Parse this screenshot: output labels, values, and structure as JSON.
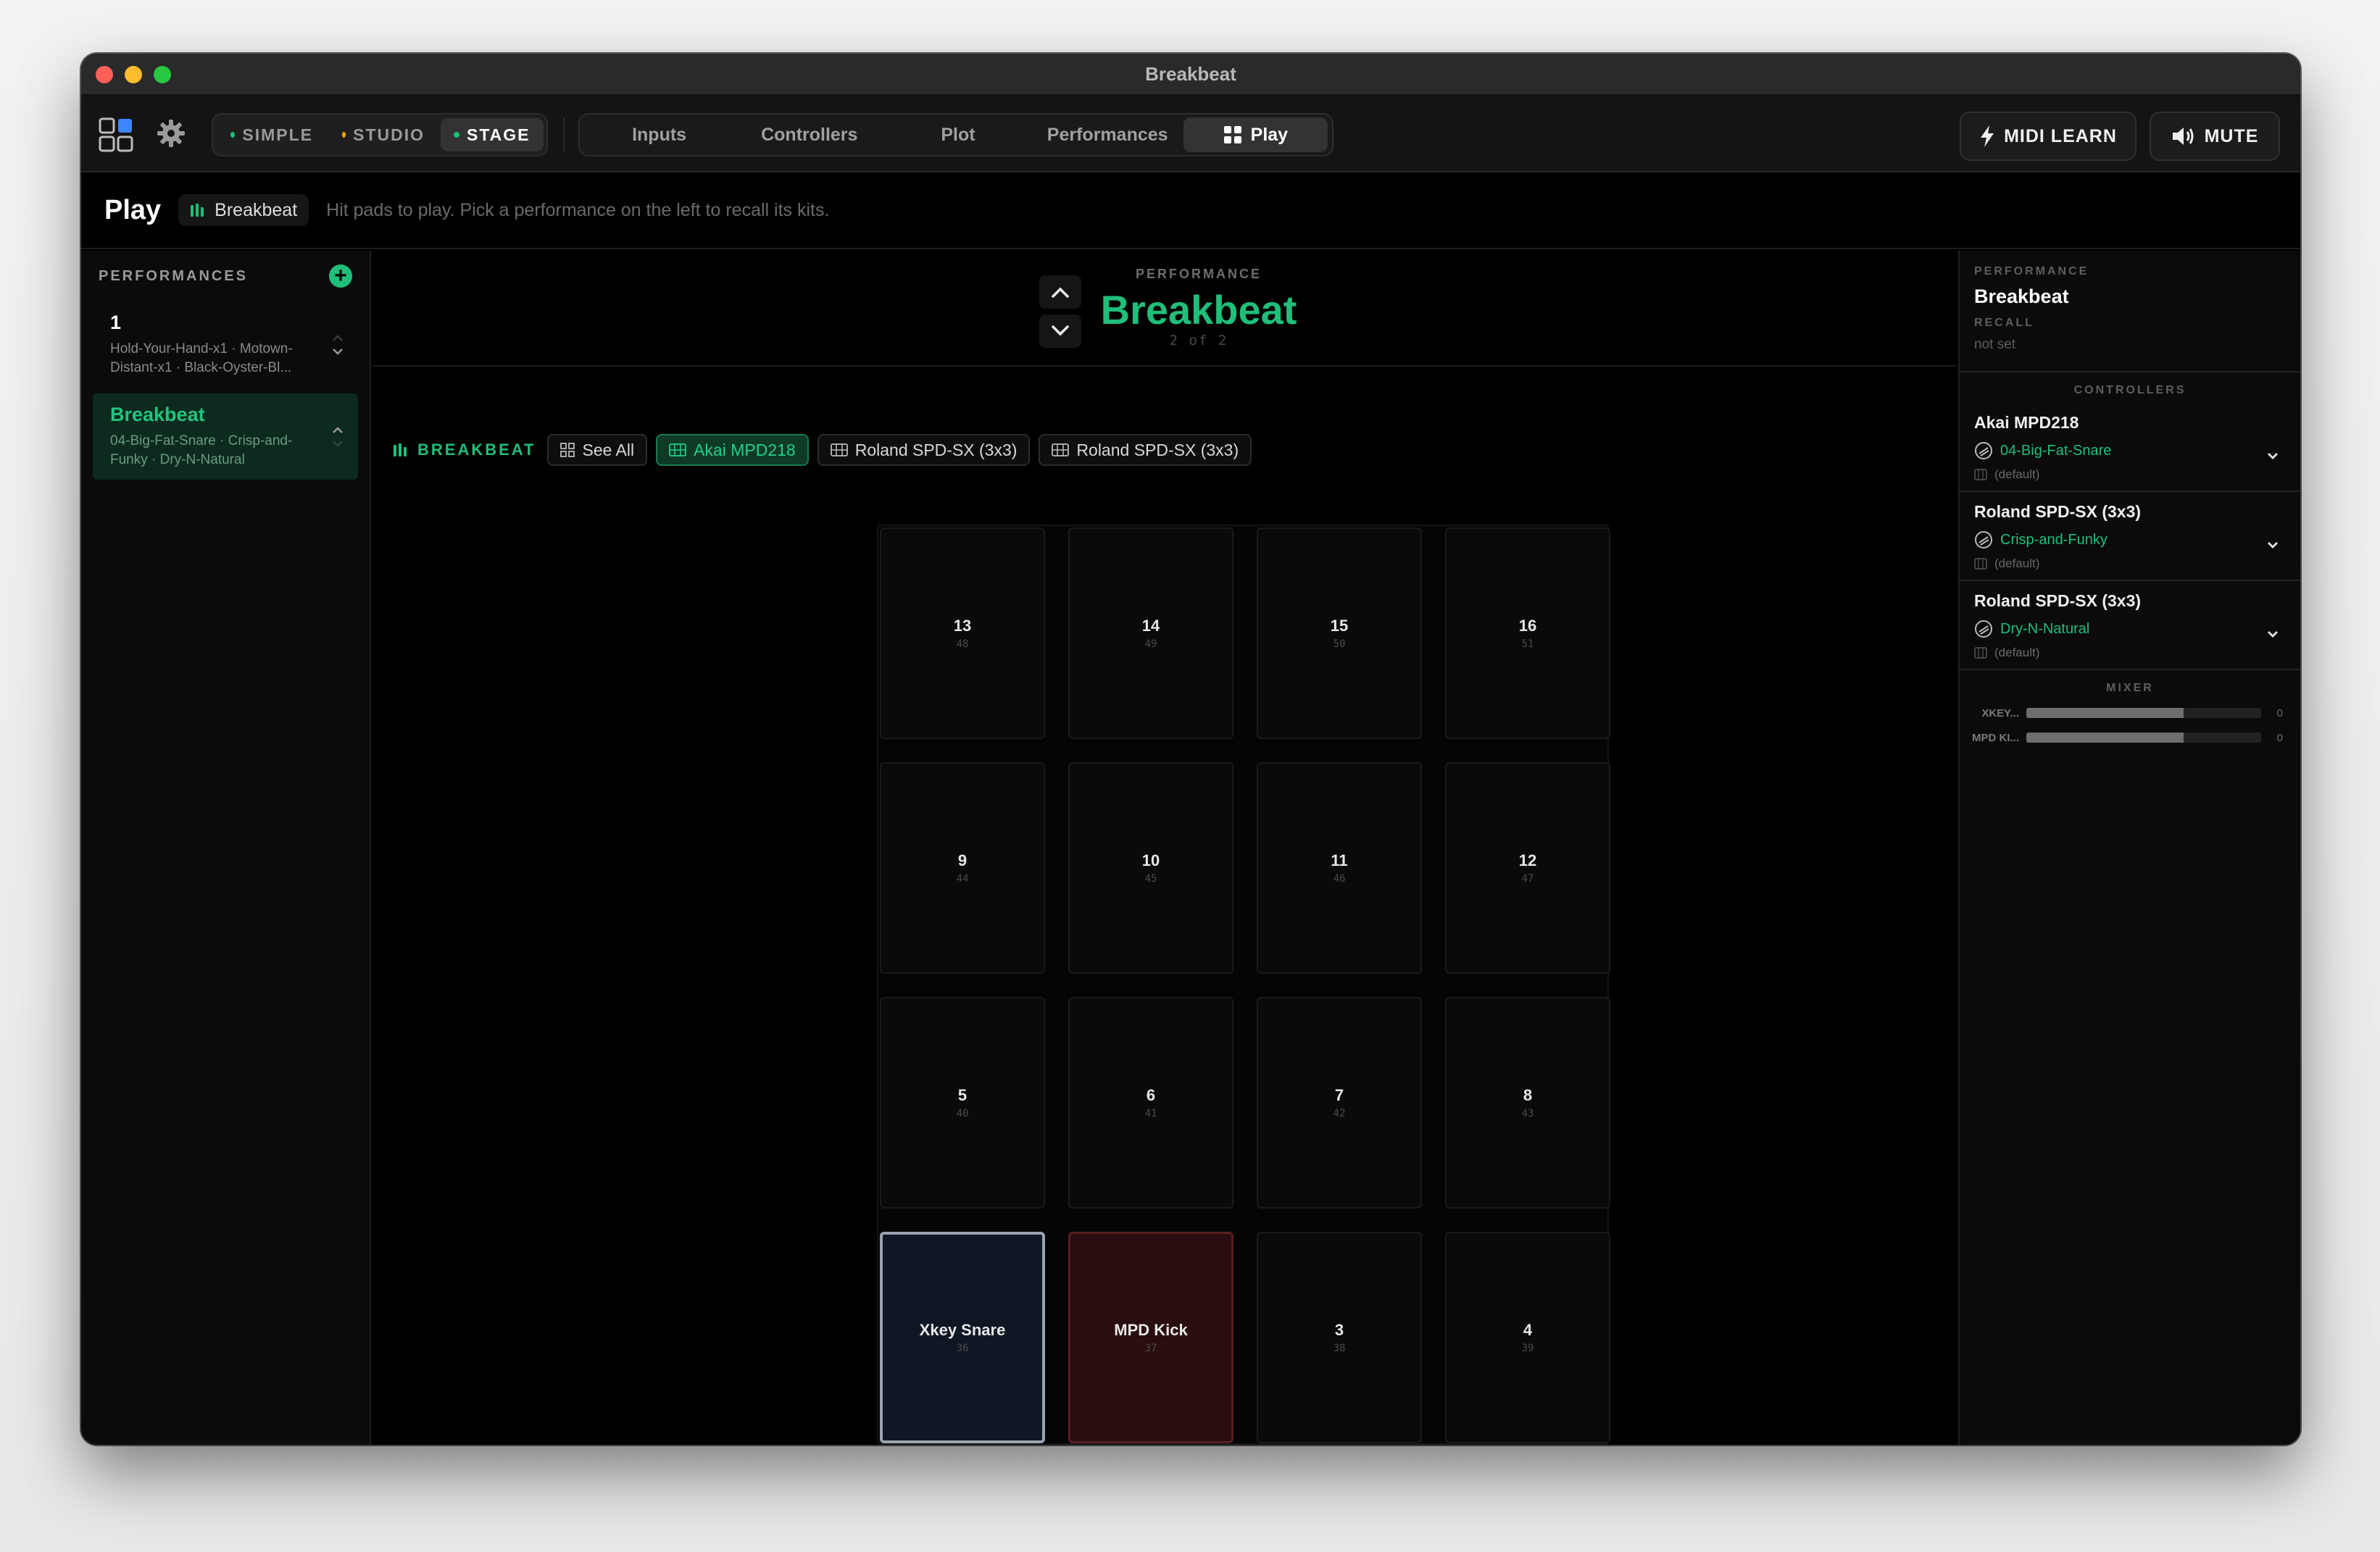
{
  "window": {
    "title": "Breakbeat"
  },
  "toolbar": {
    "modes": [
      {
        "label": "SIMPLE",
        "dot_color": "#1fbf7a",
        "active": false
      },
      {
        "label": "STUDIO",
        "dot_color": "#f0a500",
        "active": false
      },
      {
        "label": "STAGE",
        "dot_color": "#1fbf7a",
        "active": true
      }
    ],
    "tabs": [
      {
        "label": "Inputs",
        "active": false
      },
      {
        "label": "Controllers",
        "active": false
      },
      {
        "label": "Plot",
        "active": false
      },
      {
        "label": "Performances",
        "active": false
      },
      {
        "label": "Play",
        "active": true,
        "icon": "grid-icon"
      }
    ],
    "midi_learn_label": "MIDI LEARN",
    "mute_label": "MUTE"
  },
  "page": {
    "title": "Play",
    "performance_chip": "Breakbeat",
    "hint": "Hit pads to play. Pick a performance on the left to recall its kits."
  },
  "sidebar": {
    "header": "PERFORMANCES",
    "items": [
      {
        "title": "1",
        "subtitle": "Hold-Your-Hand-x1 · Motown-Distant-x1 · Black-Oyster-Bl...",
        "active": false
      },
      {
        "title": "Breakbeat",
        "subtitle": "04-Big-Fat-Snare · Crisp-and-Funky · Dry-N-Natural",
        "active": true
      }
    ]
  },
  "performance": {
    "kicker": "PERFORMANCE",
    "name": "Breakbeat",
    "count": "2 of 2"
  },
  "filters": {
    "tag": "BREAKBEAT",
    "see_all": "See All",
    "controllers": [
      {
        "label": "Akai MPD218",
        "active": true
      },
      {
        "label": "Roland SPD-SX (3x3)",
        "active": false
      },
      {
        "label": "Roland SPD-SX (3x3)",
        "active": false
      }
    ]
  },
  "pads": [
    {
      "label": "13",
      "note": "48",
      "style": "empty"
    },
    {
      "label": "14",
      "note": "49",
      "style": "empty"
    },
    {
      "label": "15",
      "note": "50",
      "style": "empty"
    },
    {
      "label": "16",
      "note": "51",
      "style": "empty"
    },
    {
      "label": "9",
      "note": "44",
      "style": "empty"
    },
    {
      "label": "10",
      "note": "45",
      "style": "empty"
    },
    {
      "label": "11",
      "note": "46",
      "style": "empty"
    },
    {
      "label": "12",
      "note": "47",
      "style": "empty"
    },
    {
      "label": "5",
      "note": "40",
      "style": "empty"
    },
    {
      "label": "6",
      "note": "41",
      "style": "empty"
    },
    {
      "label": "7",
      "note": "42",
      "style": "empty"
    },
    {
      "label": "8",
      "note": "43",
      "style": "empty"
    },
    {
      "label": "Xkey Snare",
      "note": "36",
      "style": "snare"
    },
    {
      "label": "MPD Kick",
      "note": "37",
      "style": "kick"
    },
    {
      "label": "3",
      "note": "38",
      "style": "empty"
    },
    {
      "label": "4",
      "note": "39",
      "style": "empty"
    }
  ],
  "right_panel": {
    "performance_kicker": "PERFORMANCE",
    "performance_name": "Breakbeat",
    "recall_kicker": "RECALL",
    "recall_value": "not set",
    "controllers_title": "CONTROLLERS",
    "controllers": [
      {
        "name": "Akai MPD218",
        "kit": "04-Big-Fat-Snare",
        "mapping": "(default)"
      },
      {
        "name": "Roland SPD-SX (3x3)",
        "kit": "Crisp-and-Funky",
        "mapping": "(default)"
      },
      {
        "name": "Roland SPD-SX (3x3)",
        "kit": "Dry-N-Natural",
        "mapping": "(default)"
      }
    ],
    "mixer_title": "MIXER",
    "mixer": [
      {
        "name": "XKEY...",
        "level": 0.67,
        "value": "0"
      },
      {
        "name": "MPD KI...",
        "level": 0.67,
        "value": "0"
      }
    ]
  },
  "colors": {
    "accent": "#1fbf7a",
    "background": "#000000"
  }
}
